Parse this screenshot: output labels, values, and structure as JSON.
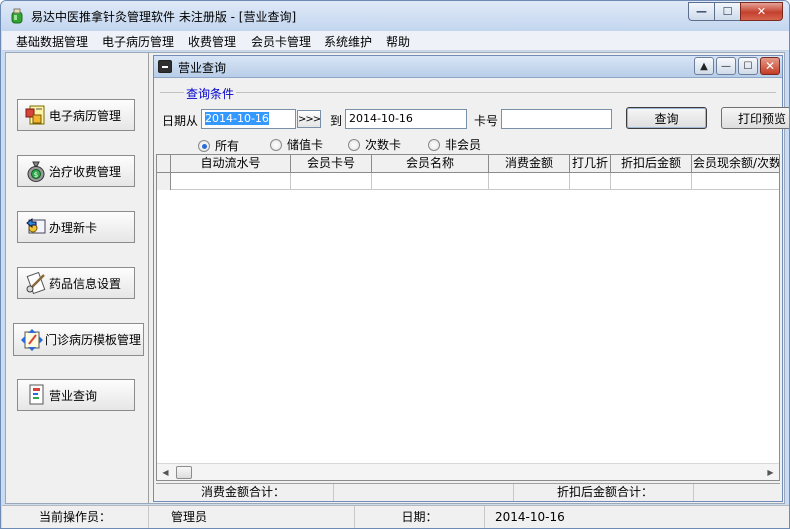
{
  "window": {
    "title": "易达中医推拿针灸管理软件 未注册版 - [营业查询]",
    "controls": {
      "minimize": "—",
      "maximize": "☐",
      "close": "✕"
    }
  },
  "menubar": {
    "items": [
      "基础数据管理",
      "电子病历管理",
      "收费管理",
      "会员卡管理",
      "系统维护",
      "帮助"
    ]
  },
  "sidebar": {
    "items": [
      {
        "label": "电子病历管理",
        "icon": "medical-record-icon"
      },
      {
        "label": "治疗收费管理",
        "icon": "money-bag-icon"
      },
      {
        "label": "办理新卡",
        "icon": "new-card-icon"
      },
      {
        "label": "药品信息设置",
        "icon": "medicine-settings-icon"
      },
      {
        "label": "门诊病历模板管理",
        "icon": "template-edit-icon"
      },
      {
        "label": "营业查询",
        "icon": "business-query-icon"
      }
    ]
  },
  "child_window": {
    "title": "营业查询",
    "controls": {
      "restore": "▲",
      "minimize": "—",
      "maximize": "☐",
      "close": "✕"
    }
  },
  "query": {
    "group_title": "查询条件",
    "date_from_label": "日期从",
    "date_from_value": "2014-10-16",
    "date_picker_label": ">>>",
    "to_label": "到",
    "date_to_value": "2014-10-16",
    "card_label": "卡号",
    "card_value": "",
    "query_button": "查询",
    "print_button": "打印预览",
    "radios": [
      {
        "label": "所有",
        "checked": true
      },
      {
        "label": "储值卡",
        "checked": false
      },
      {
        "label": "次数卡",
        "checked": false
      },
      {
        "label": "非会员",
        "checked": false
      }
    ]
  },
  "grid": {
    "columns": [
      "自动流水号",
      "会员卡号",
      "会员名称",
      "消费金额",
      "打几折",
      "折扣后金额",
      "会员现余额/次数"
    ],
    "rows": []
  },
  "summary": {
    "consumption_total_label": "消费金额合计：",
    "consumption_total_value": "",
    "discount_total_label": "折扣后金额合计：",
    "discount_total_value": ""
  },
  "statusbar": {
    "operator_label": "当前操作员：",
    "operator_value": "管理员",
    "date_label": "日期：",
    "date_value": "2014-10-16"
  },
  "colors": {
    "title_gradient_top": "#dfe9f7",
    "selection": "#3399ff",
    "group_title": "#0000cc",
    "close_button": "#c4412e"
  }
}
